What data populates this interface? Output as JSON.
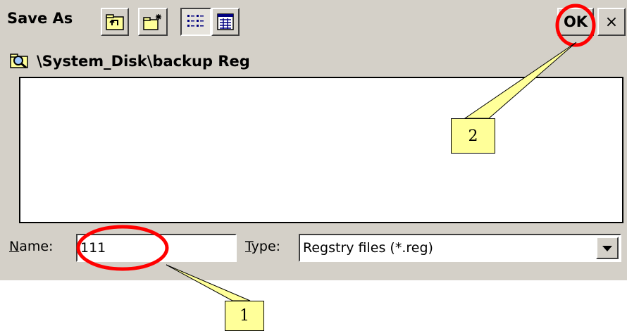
{
  "dialog": {
    "title": "Save As",
    "toolbar": {
      "buttons": [
        {
          "name": "up-folder",
          "icon": "up-folder-icon"
        },
        {
          "name": "new-folder",
          "icon": "new-folder-icon"
        },
        {
          "name": "list-view",
          "icon": "list-view-icon",
          "pressed": true
        },
        {
          "name": "details-view",
          "icon": "details-view-icon"
        }
      ],
      "ok_label": "OK",
      "close_label": "×"
    },
    "path": {
      "icon": "folder-search-icon",
      "text": "\\System_Disk\\backup Reg"
    },
    "file_list": [],
    "name_field": {
      "label_accel": "N",
      "label_rest": "ame:",
      "value": "111"
    },
    "type_field": {
      "label_accel": "T",
      "label_rest": "ype:",
      "selected": "Regstry files (*.reg)",
      "arrow_icon": "chevron-down-icon"
    }
  },
  "annotations": {
    "callout_1": "1",
    "callout_2": "2",
    "highlight_color": "#ff0000",
    "callout_color": "#ffff99"
  }
}
